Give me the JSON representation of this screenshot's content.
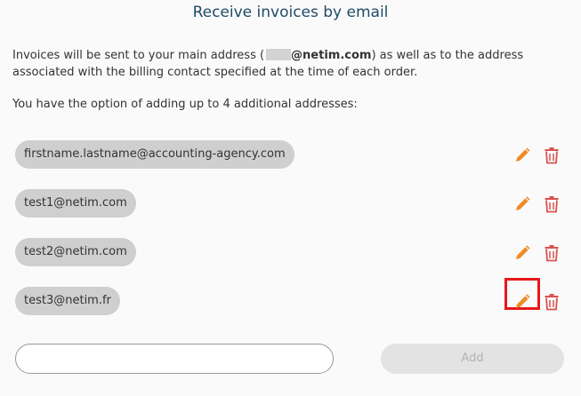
{
  "title": "Receive invoices by email",
  "intro": {
    "before": "Invoices will be sent to your main address (",
    "domain": "@netim.com",
    "after": ") as well as to the address associated with the billing contact specified at the time of each order."
  },
  "option_text": "You have the option of adding up to 4 additional addresses:",
  "addresses": [
    "firstname.lastname@accounting-agency.com",
    "test1@netim.com",
    "test2@netim.com",
    "test3@netim.fr"
  ],
  "new_address": {
    "value": "",
    "placeholder": ""
  },
  "add_label": "Add",
  "icons": {
    "edit": "pencil-icon",
    "delete": "trash-icon"
  },
  "colors": {
    "title": "#1f4b66",
    "edit_icon": "#f08a24",
    "delete_icon": "#d9534f",
    "pill_bg": "#cfcfcf",
    "highlight": "#e8171b"
  }
}
